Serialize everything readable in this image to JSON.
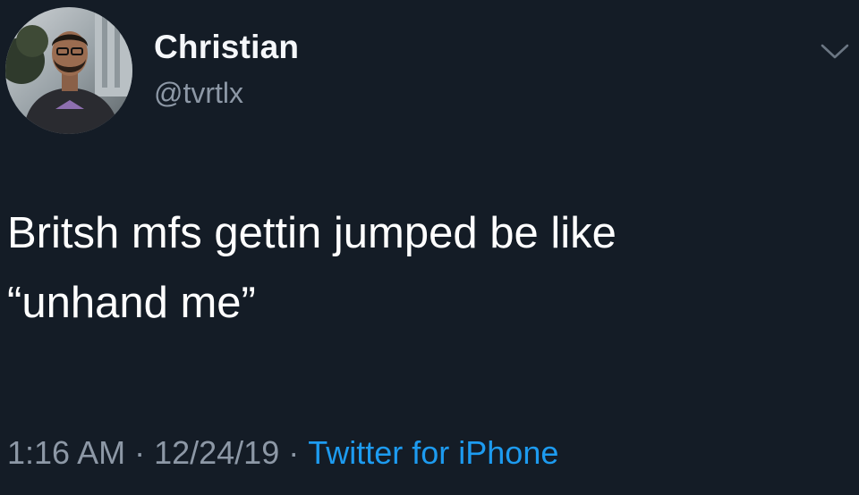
{
  "user": {
    "display_name": "Christian",
    "handle": "@tvrtlx",
    "avatar_icon": "profile-photo"
  },
  "tweet": {
    "lines": [
      "Britsh mfs gettin jumped be like",
      "“unhand me”"
    ]
  },
  "meta": {
    "time": "1:16 AM",
    "separator": "·",
    "date": "12/24/19",
    "source": "Twitter for iPhone"
  },
  "icons": {
    "menu": "chevron-down-icon"
  },
  "colors": {
    "background": "#141c26",
    "text": "#ffffff",
    "secondary": "#8d98a6",
    "link": "#1d9bf0"
  }
}
